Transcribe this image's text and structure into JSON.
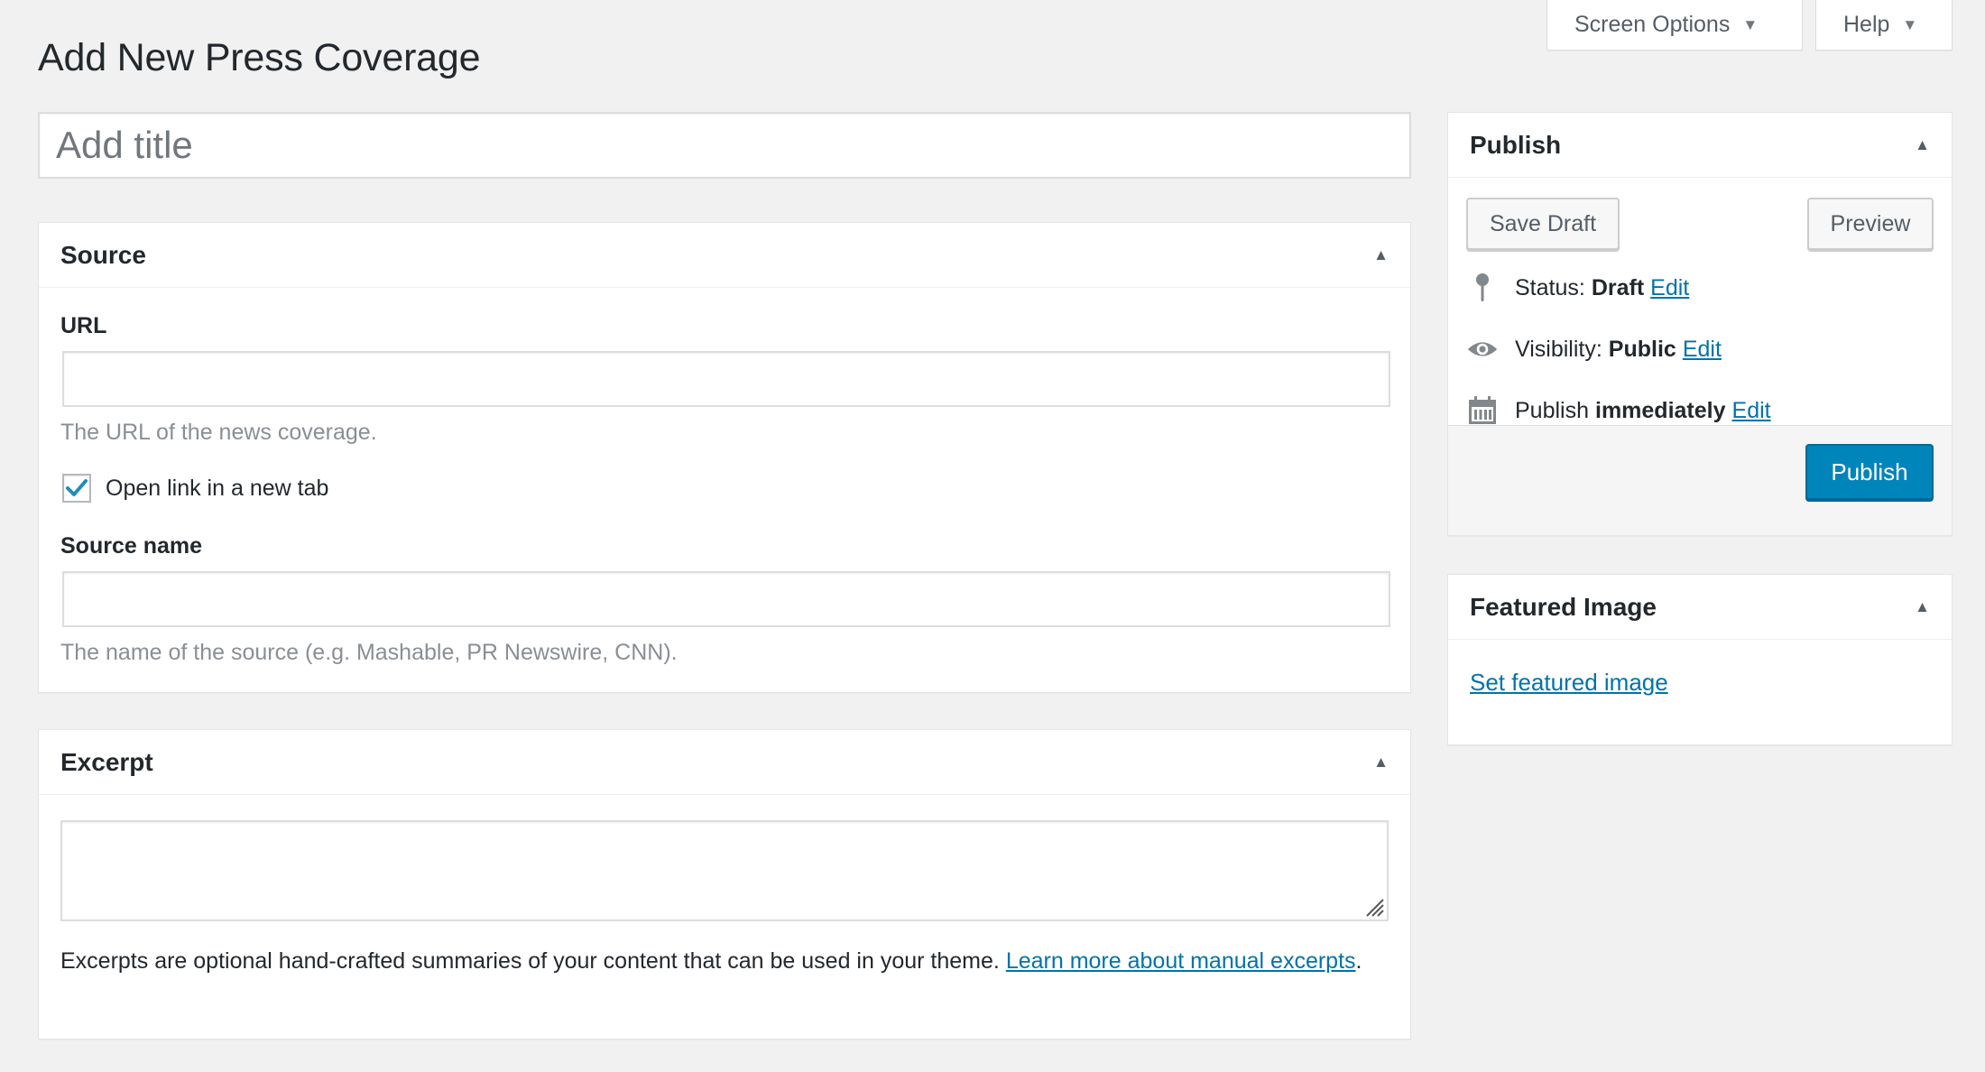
{
  "header": {
    "screen_options_label": "Screen Options",
    "help_label": "Help",
    "page_title": "Add New Press Coverage"
  },
  "title_field": {
    "placeholder": "Add title"
  },
  "source_box": {
    "heading": "Source",
    "url_label": "URL",
    "url_value": "",
    "url_description": "The URL of the news coverage.",
    "new_tab_label": "Open link in a new tab",
    "new_tab_checked": true,
    "source_name_label": "Source name",
    "source_name_value": "",
    "source_name_description": "The name of the source (e.g. Mashable, PR Newswire, CNN)."
  },
  "excerpt_box": {
    "heading": "Excerpt",
    "value": "",
    "description": "Excerpts are optional hand-crafted summaries of your content that can be used in your theme.",
    "learn_more_link": "Learn more about manual excerpts",
    "period": "."
  },
  "publish_box": {
    "heading": "Publish",
    "save_draft_label": "Save Draft",
    "preview_label": "Preview",
    "status_label": "Status:",
    "status_value": "Draft",
    "visibility_label": "Visibility:",
    "visibility_value": "Public",
    "publish_label": "Publish",
    "publish_value": "immediately",
    "edit_label": "Edit",
    "publish_button_label": "Publish"
  },
  "featured_image_box": {
    "heading": "Featured Image",
    "set_link_label": "Set featured image"
  },
  "icons": {
    "toggle": "arrow-up-icon",
    "caret": "caret-down-icon",
    "status": "pin-icon",
    "visibility": "eye-icon",
    "schedule": "calendar-icon"
  },
  "colors": {
    "primary": "#0085ba",
    "link": "#0073aa",
    "background": "#f1f1f1",
    "text": "#23282d"
  }
}
